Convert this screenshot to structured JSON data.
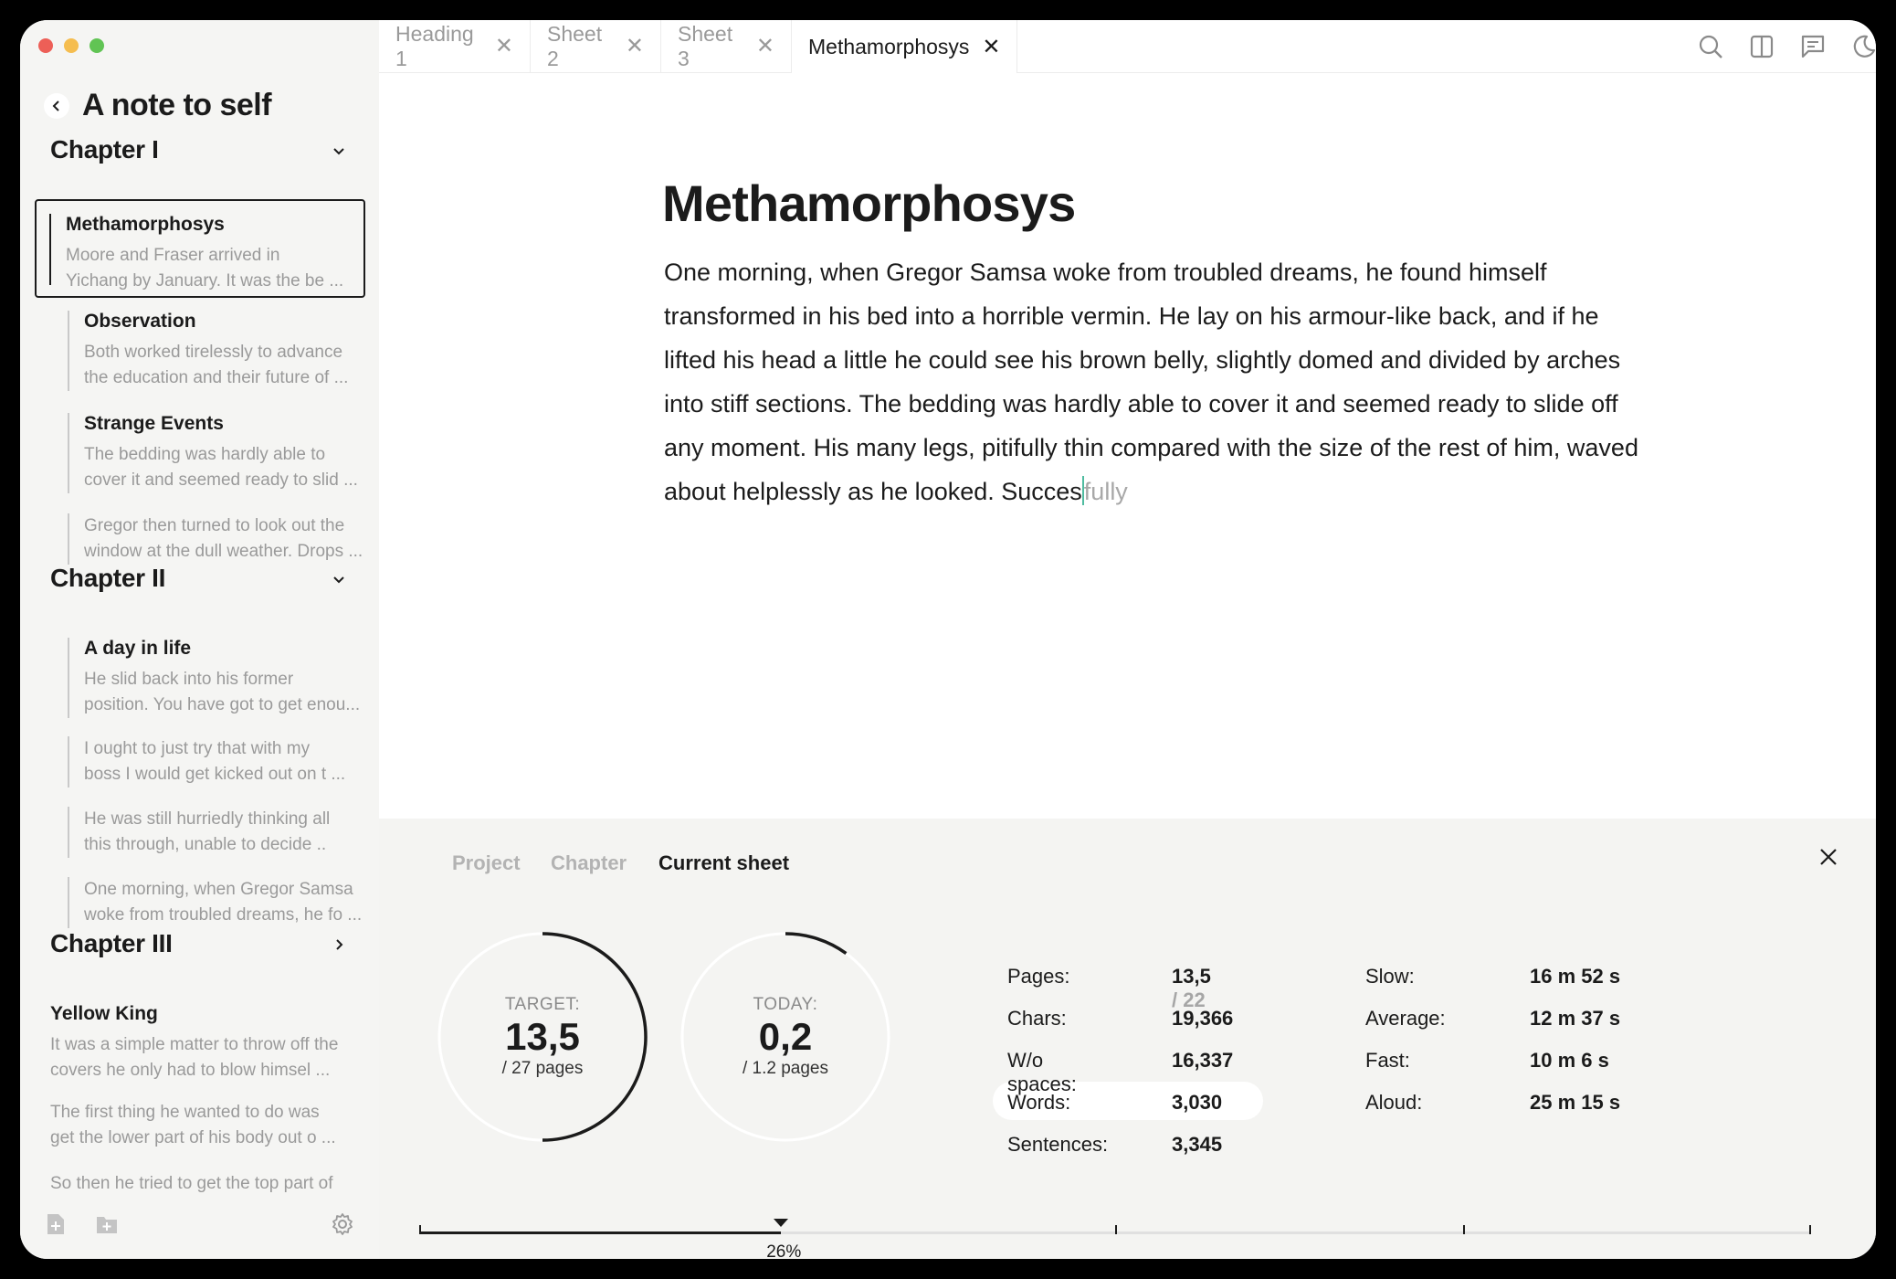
{
  "window": {
    "controls": [
      "#ed5f57",
      "#f5bd4f",
      "#61c454"
    ]
  },
  "sidebar": {
    "title": "A note to self",
    "chapters": [
      {
        "name": "Chapter I",
        "expanded": true
      },
      {
        "name": "Chapter II",
        "expanded": true
      },
      {
        "name": "Chapter III",
        "expanded": false
      }
    ],
    "notes": [
      {
        "title": "Methamorphosys",
        "l1": "Moore and Fraser arrived in",
        "l2": "Yichang by January. It was the be ..."
      },
      {
        "title": "Observation",
        "l1": "Both worked tirelessly to advance",
        "l2": "the education and their future of  ..."
      },
      {
        "title": "Strange Events",
        "l1": "The bedding was hardly able to",
        "l2": "cover it and seemed ready to slid ..."
      },
      {
        "title": "",
        "l1": "Gregor then turned to look out the",
        "l2": "window at the dull weather. Drops ..."
      },
      {
        "title": "A day in life",
        "l1": "He slid back into his former",
        "l2": "position. You have got to get enou..."
      },
      {
        "title": "",
        "l1": "I ought to just try that with my",
        "l2": "boss    I would get kicked out on t  ..."
      },
      {
        "title": "",
        "l1": "He was still hurriedly thinking all",
        "l2": "this through, unable to decide .."
      },
      {
        "title": "",
        "l1": "One morning, when Gregor Samsa",
        "l2": "woke from troubled dreams, he fo ..."
      },
      {
        "title": "Yellow King",
        "l1": "It was a simple matter to throw off the",
        "l2": "covers    he only had to blow himsel ..."
      },
      {
        "title": "",
        "l1": "The first thing he wanted to do was",
        "l2": "get the lower part of his body out o ..."
      },
      {
        "title": "",
        "l1": "So then he tried to get the top part of",
        "l2": ""
      }
    ]
  },
  "tabs": [
    {
      "label": "Heading 1"
    },
    {
      "label": "Sheet 2"
    },
    {
      "label": "Sheet 3"
    },
    {
      "label": "Methamorphosys"
    }
  ],
  "toolbar": {
    "icons": [
      "search-icon",
      "split-view-icon",
      "comments-icon",
      "dark-mode-icon"
    ]
  },
  "editor": {
    "title": "Methamorphosys",
    "body": "One morning, when Gregor Samsa woke from troubled dreams, he found himself transformed in his bed into a horrible vermin. He lay on his armour-like back, and if he lifted his head a little he could see his brown belly, slightly domed and divided by arches into stiff sections. The bedding was hardly able to cover it and seemed ready to slide off any moment. His many legs, pitifully thin compared with the size of the rest of him, waved about helplessly as he looked. Succes",
    "suggestion": "fully",
    "caret_color": "#4fbca0"
  },
  "stats": {
    "tabs": [
      "Project",
      "Chapter",
      "Current sheet"
    ],
    "active_tab": 2,
    "target": {
      "label": "TARGET:",
      "value": "13,5",
      "sub": "/ 27 pages",
      "progress": 0.5
    },
    "today": {
      "label": "TODAY:",
      "value": "0,2",
      "sub": "/ 1.2 pages",
      "progress": 0.1
    },
    "left": [
      {
        "label": "Pages:",
        "value": "13,5",
        "extra": "/ 22"
      },
      {
        "label": "Chars:",
        "value": "19,366",
        "extra": ""
      },
      {
        "label": "W/o spaces:",
        "value": "16,337",
        "extra": ""
      },
      {
        "label": "Words:",
        "value": "3,030",
        "extra": ""
      },
      {
        "label": "Sentences:",
        "value": "3,345",
        "extra": ""
      }
    ],
    "right": [
      {
        "label": "Slow:",
        "value": "16 m 52 s"
      },
      {
        "label": "Average:",
        "value": "12 m 37 s"
      },
      {
        "label": "Fast:",
        "value": "10 m 6 s"
      },
      {
        "label": "Aloud:",
        "value": "25 m 15 s"
      }
    ],
    "progress": {
      "label": "26%",
      "fraction": 0.26
    }
  }
}
